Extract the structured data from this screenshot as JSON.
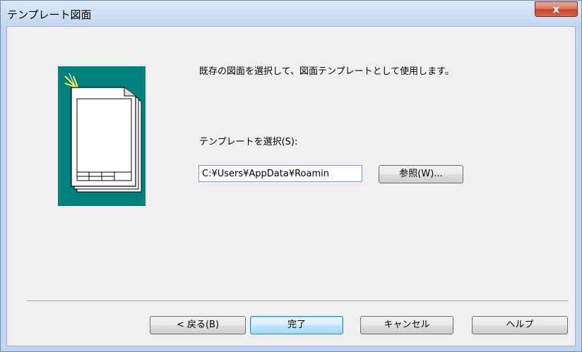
{
  "window": {
    "title": "テンプレート図面",
    "close_label": "x"
  },
  "main": {
    "description": "既存の図面を選択して、図面テンプレートとして使用します。",
    "select_label": "テンプレートを選択(S):",
    "path_value": "C:¥Users¥AppData¥Roamin",
    "browse_label": "参照(W)..."
  },
  "footer": {
    "back_label": "< 戻る(B)",
    "finish_label": "完了",
    "cancel_label": "キャンセル",
    "help_label": "ヘルプ"
  },
  "colors": {
    "illustration_bg": "#00807e",
    "titlebar": "#c4d7ef",
    "close_button": "#c7432a"
  },
  "icons": {
    "illustration": "template-document-icon"
  }
}
